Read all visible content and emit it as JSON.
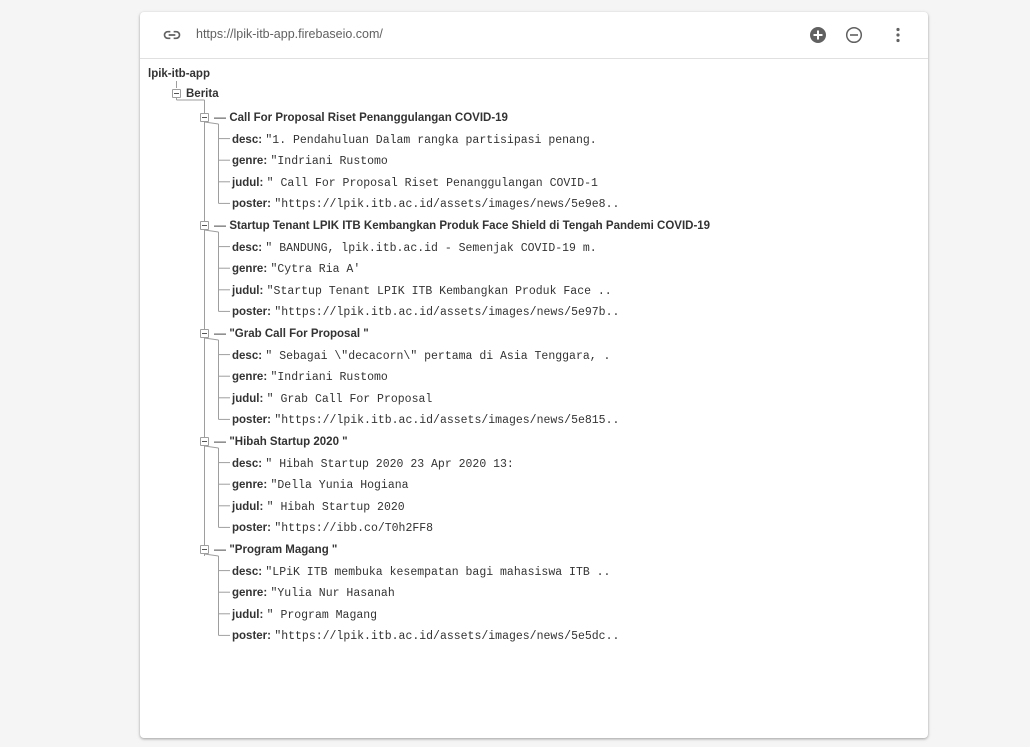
{
  "header": {
    "url": "https://lpik-itb-app.firebaseio.com/"
  },
  "colors": {
    "line": "#9e9e9e",
    "text": "#333333",
    "icon": "#616161"
  },
  "tree": {
    "root": "lpik-itb-app",
    "parent": "Berita",
    "items": [
      {
        "title": "Call For Proposal Riset Penanggulangan COVID-19",
        "fields": [
          {
            "key": "desc:",
            "value": "\"1. Pendahuluan  Dalam rangka partisipasi penang."
          },
          {
            "key": "genre:",
            "value": "\"Indriani Rustomo"
          },
          {
            "key": "judul:",
            "value": "\" Call For Proposal Riset Penanggulangan COVID-1"
          },
          {
            "key": "poster:",
            "value": "\"https://lpik.itb.ac.id/assets/images/news/5e9e8.."
          }
        ]
      },
      {
        "title": "Startup Tenant LPIK ITB Kembangkan Produk Face Shield di Tengah Pandemi COVID-19",
        "fields": [
          {
            "key": "desc:",
            "value": "\"  BANDUNG, lpik.itb.ac.id - Semenjak COVID-19 m."
          },
          {
            "key": "genre:",
            "value": "\"Cytra Ria A'"
          },
          {
            "key": "judul:",
            "value": "\"Startup Tenant LPIK ITB Kembangkan Produk Face .."
          },
          {
            "key": "poster:",
            "value": "\"https://lpik.itb.ac.id/assets/images/news/5e97b.."
          }
        ]
      },
      {
        "title": "\"Grab Call For Proposal \"",
        "fields": [
          {
            "key": "desc:",
            "value": "\"  Sebagai \\\"decacorn\\\" pertama di Asia Tenggara, ."
          },
          {
            "key": "genre:",
            "value": "\"Indriani Rustomo"
          },
          {
            "key": "judul:",
            "value": "\" Grab Call For Proposal"
          },
          {
            "key": "poster:",
            "value": "\"https://lpik.itb.ac.id/assets/images/news/5e815.."
          }
        ]
      },
      {
        "title": "\"Hibah Startup 2020 \"",
        "fields": [
          {
            "key": "desc:",
            "value": "\" Hibah Startup 2020      23 Apr 2020 13:"
          },
          {
            "key": "genre:",
            "value": "\"Della Yunia Hogiana"
          },
          {
            "key": "judul:",
            "value": "\" Hibah Startup 2020"
          },
          {
            "key": "poster:",
            "value": "\"https://ibb.co/T0h2FF8"
          }
        ]
      },
      {
        "title": "\"Program Magang \"",
        "fields": [
          {
            "key": "desc:",
            "value": "\"LPiK ITB membuka kesempatan bagi mahasiswa ITB .."
          },
          {
            "key": "genre:",
            "value": "\"Yulia Nur Hasanah"
          },
          {
            "key": "judul:",
            "value": "\" Program Magang"
          },
          {
            "key": "poster:",
            "value": "\"https://lpik.itb.ac.id/assets/images/news/5e5dc.."
          }
        ]
      }
    ]
  }
}
